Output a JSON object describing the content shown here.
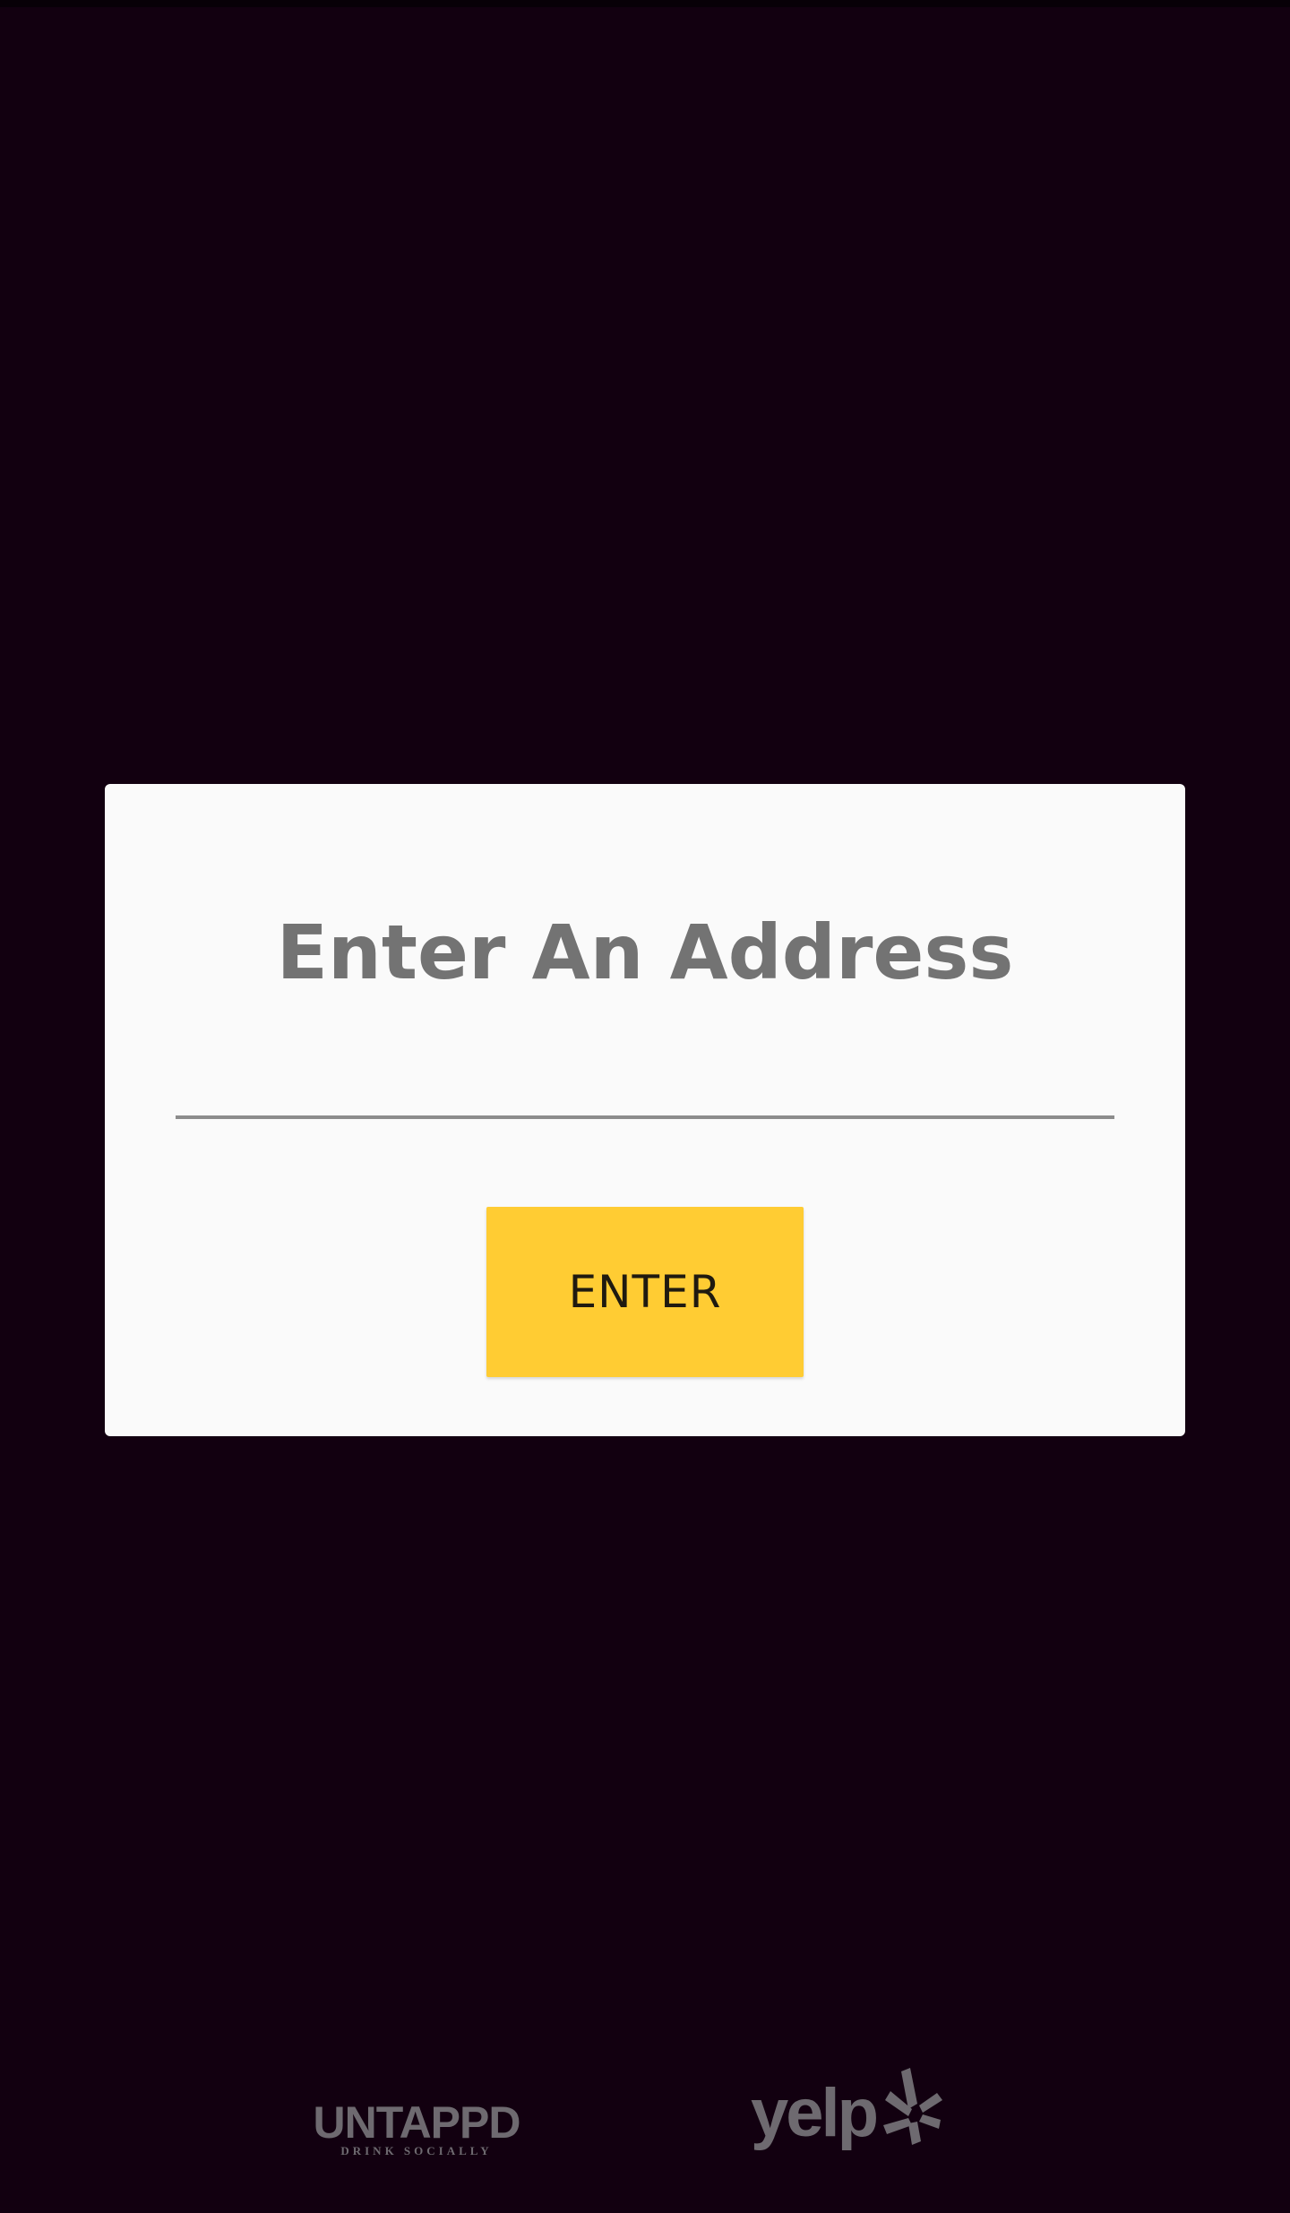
{
  "dialog": {
    "title": "Enter An Address",
    "address_input": {
      "value": "",
      "placeholder": ""
    },
    "enter_button_label": "ENTER"
  },
  "footer": {
    "untappd_logo": {
      "icon": "untappd-logo",
      "wordmark": "UNTAPPD",
      "tagline": "DRINK SOCIALLY"
    },
    "yelp_logo": {
      "icon": "yelp-logo",
      "wordmark": "yelp"
    }
  },
  "colors": {
    "background": "#120010",
    "dialog_background": "#fafafa",
    "title_text": "#737373",
    "button_background": "#ffcc33",
    "button_text": "#1f1a10",
    "input_underline": "#8c8c8c",
    "logo_gray": "#6e6a70"
  }
}
